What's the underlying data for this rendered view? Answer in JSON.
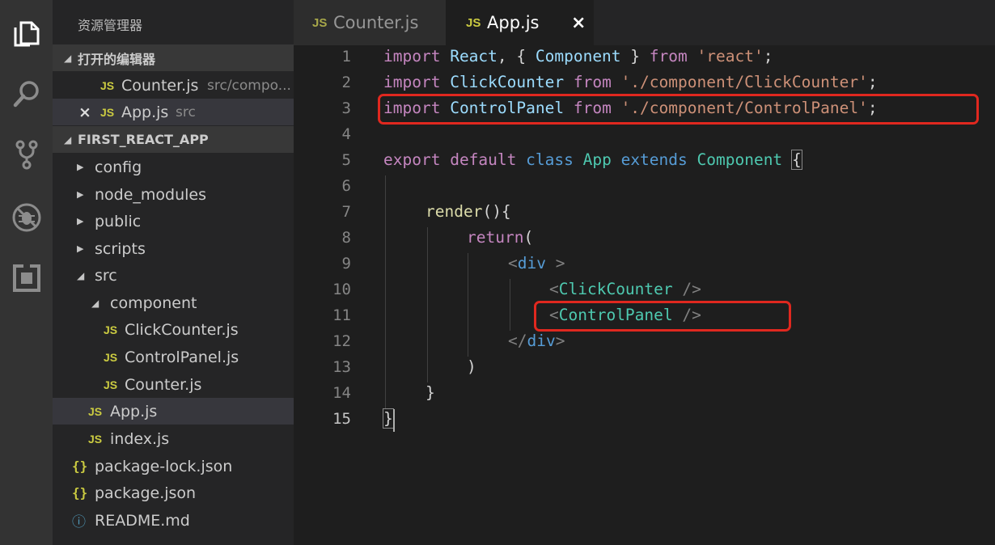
{
  "activity_bar": {
    "icons": [
      "files-icon",
      "search-icon",
      "source-control-icon",
      "debug-icon",
      "extensions-icon"
    ]
  },
  "explorer": {
    "title": "资源管理器",
    "open_editors": {
      "header": "打开的编辑器",
      "items": [
        {
          "name": "Counter.js",
          "desc": "src/compo..."
        },
        {
          "name": "App.js",
          "desc": "src"
        }
      ]
    },
    "project": {
      "header": "FIRST_REACT_APP",
      "items": [
        {
          "label": "config"
        },
        {
          "label": "node_modules"
        },
        {
          "label": "public"
        },
        {
          "label": "scripts"
        },
        {
          "label": "src"
        },
        {
          "label": "component"
        },
        {
          "label": "ClickCounter.js"
        },
        {
          "label": "ControlPanel.js"
        },
        {
          "label": "Counter.js"
        },
        {
          "label": "App.js"
        },
        {
          "label": "index.js"
        },
        {
          "label": "package-lock.json"
        },
        {
          "label": "package.json"
        },
        {
          "label": "README.md"
        }
      ]
    },
    "file_badges": {
      "js": "JS",
      "json": "{}",
      "info": "ⓘ"
    }
  },
  "tabs": [
    {
      "label": "Counter.js",
      "badge": "JS"
    },
    {
      "label": "App.js",
      "badge": "JS",
      "close": "×"
    }
  ],
  "editor": {
    "line_numbers": [
      "1",
      "2",
      "3",
      "4",
      "5",
      "6",
      "7",
      "8",
      "9",
      "10",
      "11",
      "12",
      "13",
      "14",
      "15"
    ],
    "code": {
      "l1": {
        "t1": "import",
        "t2": " ",
        "t3": "React",
        "t4": ", { ",
        "t5": "Component",
        "t6": " } ",
        "t7": "from",
        "t8": " ",
        "t9": "'react'",
        "t10": ";"
      },
      "l2": {
        "t1": "import",
        "t2": " ",
        "t3": "ClickCounter",
        "t4": " ",
        "t5": "from",
        "t6": " ",
        "t7": "'./component/ClickCounter'",
        "t8": ";"
      },
      "l3": {
        "t1": "import",
        "t2": " ",
        "t3": "ControlPanel",
        "t4": " ",
        "t5": "from",
        "t6": " ",
        "t7": "'./component/ControlPanel'",
        "t8": ";"
      },
      "l5": {
        "t1": "export",
        "t2": " ",
        "t3": "default",
        "t4": " ",
        "t5": "class",
        "t6": " ",
        "t7": "App",
        "t8": " ",
        "t9": "extends",
        "t10": " ",
        "t11": "Component",
        "t12": " ",
        "t13": "{"
      },
      "l7": {
        "t1": "render",
        "t2": "(){"
      },
      "l8": {
        "t1": "return",
        "t2": "("
      },
      "l9": {
        "t1": "<",
        "t2": "div",
        "t3": " >"
      },
      "l10": {
        "t1": "<",
        "t2": "ClickCounter",
        "t3": " />"
      },
      "l11": {
        "t1": "<",
        "t2": "ControlPanel",
        "t3": " />"
      },
      "l12": {
        "t1": "</",
        "t2": "div",
        "t3": ">"
      },
      "l13": {
        "t1": ")"
      },
      "l14": {
        "t1": "}"
      },
      "l15": {
        "t1": "}"
      }
    }
  },
  "colors": {
    "highlight_box": "#e0281f",
    "keyword": "#c586c0",
    "storage": "#569cd6",
    "variable": "#9cdcfe",
    "string": "#ce9178",
    "class": "#4ec9b0",
    "function": "#dcdcaa",
    "js_badge": "#cbcb41"
  }
}
